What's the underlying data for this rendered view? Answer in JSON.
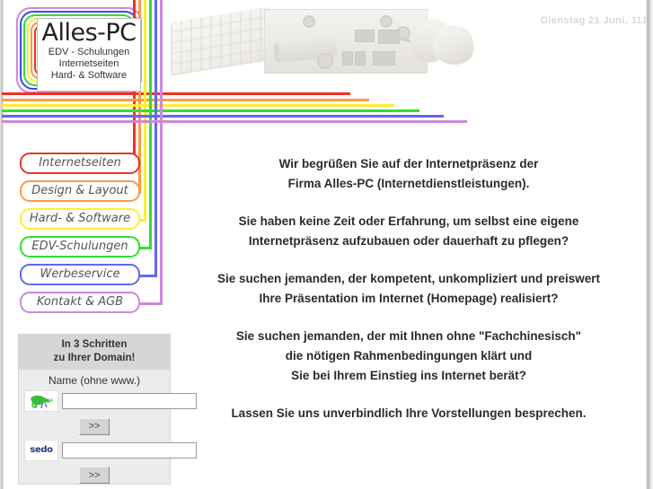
{
  "page": {
    "title": "Alles-PC",
    "date_text": "Dienstag 21 Juni, 111"
  },
  "logo": {
    "name": "Alles-PC",
    "line1": "EDV - Schulungen",
    "line2": "Internetseiten",
    "line3": "Hard- & Software",
    "frame_colors": [
      "#cc88dd",
      "#4444ee",
      "#33dd33",
      "#ffee33",
      "#ff9944",
      "#ee3322"
    ]
  },
  "header_image": {
    "alt": "keyboard-ports-mouse-photo"
  },
  "nav": {
    "items": [
      {
        "label": "Internetseiten",
        "color": "#ee3322",
        "line_end": 390
      },
      {
        "label": "Design & Layout",
        "color": "#ff9944",
        "line_end": 411
      },
      {
        "label": "Hard- & Software",
        "color": "#ffee33",
        "line_end": 439
      },
      {
        "label": "EDV-Schulungen",
        "color": "#33dd33",
        "line_end": 467
      },
      {
        "label": "Werbeservice",
        "color": "#6666ee",
        "line_end": 494
      },
      {
        "label": "Kontakt & AGB",
        "color": "#cc88dd",
        "line_end": 520
      }
    ]
  },
  "domain_form": {
    "heading_line1": "In 3 Schritten",
    "heading_line2": "zu Ihrer Domain!",
    "field_label": "Name (ohne www.)",
    "chameleon_icon": "chameleon-logo",
    "sedo_icon": "sedo-logo",
    "sedo_text": "sedo",
    "input1_value": "",
    "input1_placeholder": "",
    "input2_value": "",
    "input2_placeholder": "",
    "submit1_label": ">>",
    "submit2_label": ">>"
  },
  "content": {
    "paragraphs": [
      "Wir begrüßen Sie auf der Internetpräsenz der\nFirma Alles-PC (Internetdienstleistungen).",
      "Sie haben keine Zeit oder Erfahrung, um selbst eine eigene\nInternetpräsenz aufzubauen oder dauerhaft zu pflegen?",
      "Sie suchen jemanden, der kompetent, unkompliziert und preiswert\nIhre Präsentation im Internet (Homepage) realisiert?",
      "Sie suchen jemanden, der mit Ihnen ohne \"Fachchinesisch\"\ndie nötigen Rahmenbedingungen klärt und\nSie bei Ihrem Einstieg ins Internet berät?",
      "Lassen Sie uns unverbindlich Ihre Vorstellungen besprechen."
    ]
  }
}
